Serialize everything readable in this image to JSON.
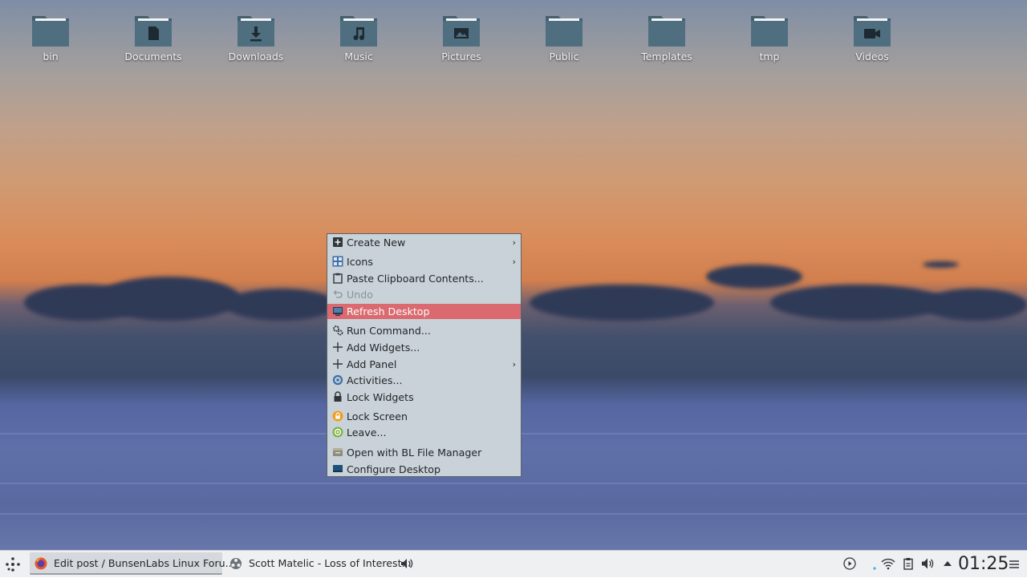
{
  "desktop": {
    "icons": [
      {
        "label": "bin",
        "glyph": "none"
      },
      {
        "label": "Documents",
        "glyph": "document-icon"
      },
      {
        "label": "Downloads",
        "glyph": "download-icon"
      },
      {
        "label": "Music",
        "glyph": "music-note-icon"
      },
      {
        "label": "Pictures",
        "glyph": "picture-icon"
      },
      {
        "label": "Public",
        "glyph": "none"
      },
      {
        "label": "Templates",
        "glyph": "none"
      },
      {
        "label": "tmp",
        "glyph": "none"
      },
      {
        "label": "Videos",
        "glyph": "video-camera-icon"
      }
    ],
    "folder_color": "#4f6f80"
  },
  "menu": {
    "items": [
      {
        "label": "Create New",
        "icon": "plus-square-icon",
        "submenu": true
      },
      {
        "label": "Icons",
        "icon": "grid-icon",
        "submenu": true
      },
      {
        "label": "Paste Clipboard Contents...",
        "icon": "clipboard-icon"
      },
      {
        "label": "Undo",
        "icon": "undo-icon",
        "disabled": true
      },
      {
        "label": "Refresh Desktop",
        "icon": "monitor-icon",
        "highlighted": true
      },
      {
        "label": "Run Command...",
        "icon": "gears-icon"
      },
      {
        "label": "Add Widgets...",
        "icon": "plus-icon"
      },
      {
        "label": "Add Panel",
        "icon": "plus-icon",
        "submenu": true
      },
      {
        "label": "Activities...",
        "icon": "activities-icon"
      },
      {
        "label": "Lock Widgets",
        "icon": "padlock-icon"
      },
      {
        "label": "Lock Screen",
        "icon": "lock-screen-icon"
      },
      {
        "label": "Leave...",
        "icon": "power-icon"
      },
      {
        "label": "Open with BL File Manager",
        "icon": "file-manager-icon"
      },
      {
        "label": "Configure Desktop",
        "icon": "configure-desktop-icon"
      }
    ],
    "highlight_color": "#da6a6f",
    "background_color": "#c8d2d8"
  },
  "taskbar": {
    "tasks": [
      {
        "label": "Edit post / BunsenLabs Linux Foru...",
        "icon": "firefox-icon"
      },
      {
        "label": "Scott Matelic - Loss of Interest...",
        "icon": "media-player-icon"
      }
    ],
    "clock": "01:25"
  }
}
